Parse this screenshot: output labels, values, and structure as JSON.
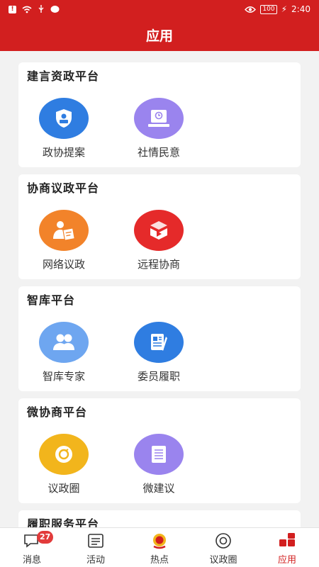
{
  "status_bar": {
    "battery": "100",
    "time": "2:40"
  },
  "header": {
    "title": "应用"
  },
  "sections": [
    {
      "title": "建言资政平台",
      "apps": [
        {
          "label": "政协提案"
        },
        {
          "label": "社情民意"
        }
      ]
    },
    {
      "title": "协商议政平台",
      "apps": [
        {
          "label": "网络议政"
        },
        {
          "label": "远程协商"
        }
      ]
    },
    {
      "title": "智库平台",
      "apps": [
        {
          "label": "智库专家"
        },
        {
          "label": "委员履职"
        }
      ]
    },
    {
      "title": "微协商平台",
      "apps": [
        {
          "label": "议政圈"
        },
        {
          "label": "微建议"
        }
      ]
    },
    {
      "title": "履职服务平台"
    }
  ],
  "bottom_nav": [
    {
      "label": "消息",
      "badge": "27"
    },
    {
      "label": "活动"
    },
    {
      "label": "热点"
    },
    {
      "label": "议政圈"
    },
    {
      "label": "应用"
    }
  ],
  "colors": {
    "brand_red": "#d21f1f",
    "icon_blue": "#2f7de1",
    "icon_purple": "#9a84ee",
    "icon_orange": "#f2832a",
    "icon_red": "#e52a2a",
    "icon_light_blue": "#6ea6f0",
    "icon_yellow": "#f2b51c"
  }
}
